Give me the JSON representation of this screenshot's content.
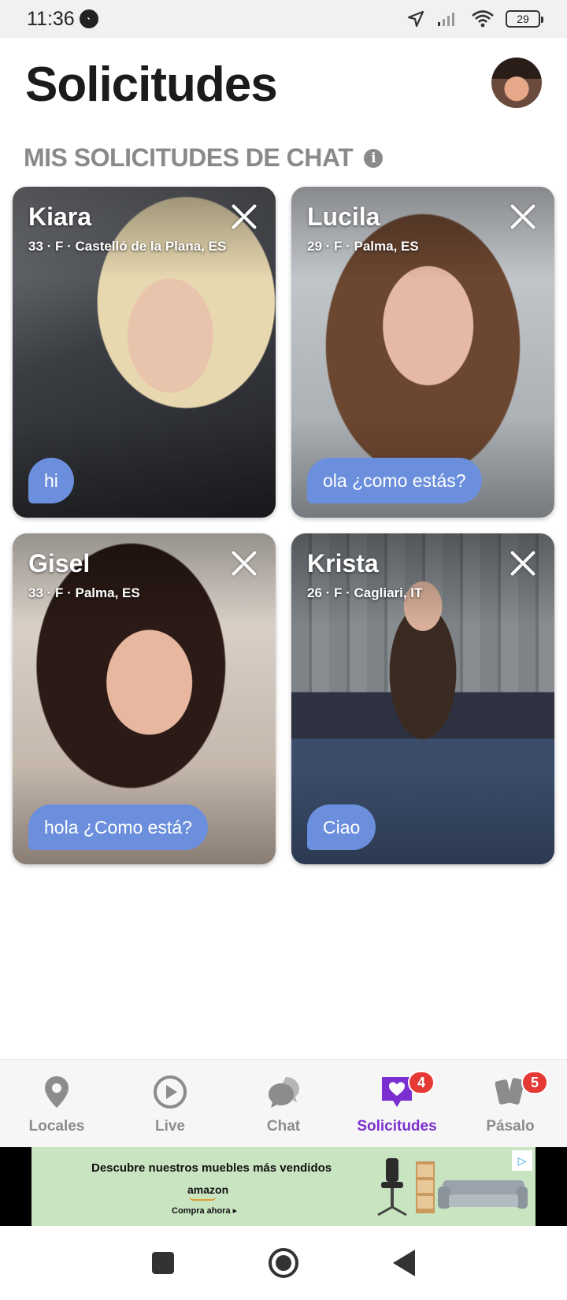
{
  "status_bar": {
    "time": "11:36",
    "battery": "29"
  },
  "header": {
    "title": "Solicitudes"
  },
  "section": {
    "title": "MIS SOLICITUDES DE CHAT"
  },
  "requests": [
    {
      "name": "Kiara",
      "meta": "33 · F · Castelló de la Plana, ES",
      "message": "hi"
    },
    {
      "name": "Lucila",
      "meta": "29 · F · Palma, ES",
      "message": "ola ¿como estás?"
    },
    {
      "name": "Gisel",
      "meta": "33 · F · Palma, ES",
      "message": "hola ¿Como está?"
    },
    {
      "name": "Krista",
      "meta": "26 · F · Cagliari, IT",
      "message": "Ciao"
    }
  ],
  "nav": [
    {
      "label": "Locales",
      "icon": "location-pin-icon"
    },
    {
      "label": "Live",
      "icon": "play-circle-icon"
    },
    {
      "label": "Chat",
      "icon": "chat-bubbles-icon"
    },
    {
      "label": "Solicitudes",
      "icon": "heart-message-icon",
      "badge": "4",
      "active": true
    },
    {
      "label": "Pásalo",
      "icon": "cards-icon",
      "badge": "5"
    }
  ],
  "ad": {
    "headline": "Descubre nuestros muebles más vendidos",
    "brand": "amazon",
    "cta": "Compra ahora ▸"
  },
  "colors": {
    "accent": "#7b2fd0",
    "bubble": "#6b8fdd",
    "badge": "#e53935"
  }
}
